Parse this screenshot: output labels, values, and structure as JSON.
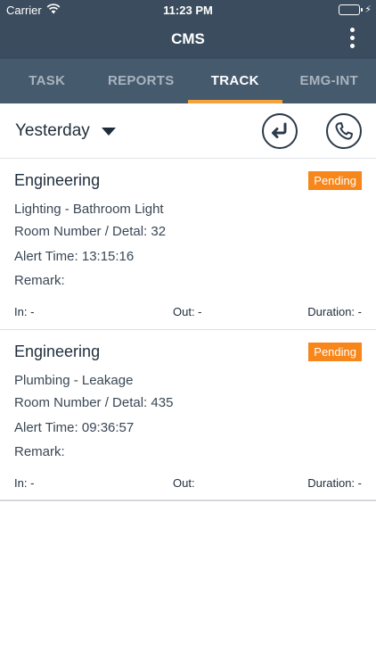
{
  "statusbar": {
    "carrier": "Carrier",
    "time": "11:23 PM",
    "battery_level_percent": 100
  },
  "navbar": {
    "title": "CMS"
  },
  "tabs": [
    {
      "label": "TASK",
      "active": false
    },
    {
      "label": "REPORTS",
      "active": false
    },
    {
      "label": "TRACK",
      "active": true
    },
    {
      "label": "EMG-INT",
      "active": false
    }
  ],
  "filter": {
    "day": "Yesterday"
  },
  "icons": {
    "back": "return-arrow-icon",
    "phone": "phone-icon",
    "more": "more-vertical-icon"
  },
  "colors": {
    "header": "#3b4c5e",
    "tabbar": "#465a6d",
    "accent": "#f5a23a",
    "badge": "#f7861b"
  },
  "tasks": [
    {
      "department": "Engineering",
      "status": "Pending",
      "category": "Lighting - Bathroom Light",
      "room": "Room Number / Detal: 32",
      "alert_time": "Alert Time: 13:15:16",
      "remark": "Remark:",
      "in": "In: -",
      "out": "Out: -",
      "duration": "Duration: -"
    },
    {
      "department": "Engineering",
      "status": "Pending",
      "category": "Plumbing - Leakage",
      "room": "Room Number / Detal: 435",
      "alert_time": "Alert Time: 09:36:57",
      "remark": "Remark:",
      "in": "In: -",
      "out": "Out:",
      "duration": "Duration: -"
    }
  ]
}
